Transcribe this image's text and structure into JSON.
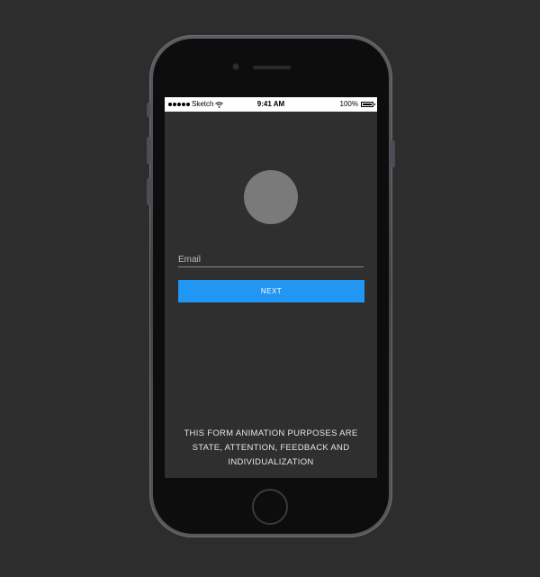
{
  "status_bar": {
    "carrier": "Sketch",
    "time": "9:41 AM",
    "battery": "100%"
  },
  "form": {
    "email_placeholder": "Email",
    "next_label": "NEXT"
  },
  "info": {
    "line1": "THIS FORM ANIMATION PURPOSES ARE",
    "line2": "STATE, ATTENTION, FEEDBACK AND",
    "line3": "INDIVIDUALIZATION"
  },
  "colors": {
    "background": "#2d2d2d",
    "screen": "#2f2f2f",
    "accent": "#2196f3",
    "avatar": "#7a7a7a"
  },
  "icons": {
    "signal": "signal-dots-icon",
    "wifi": "wifi-icon",
    "battery": "battery-icon"
  }
}
